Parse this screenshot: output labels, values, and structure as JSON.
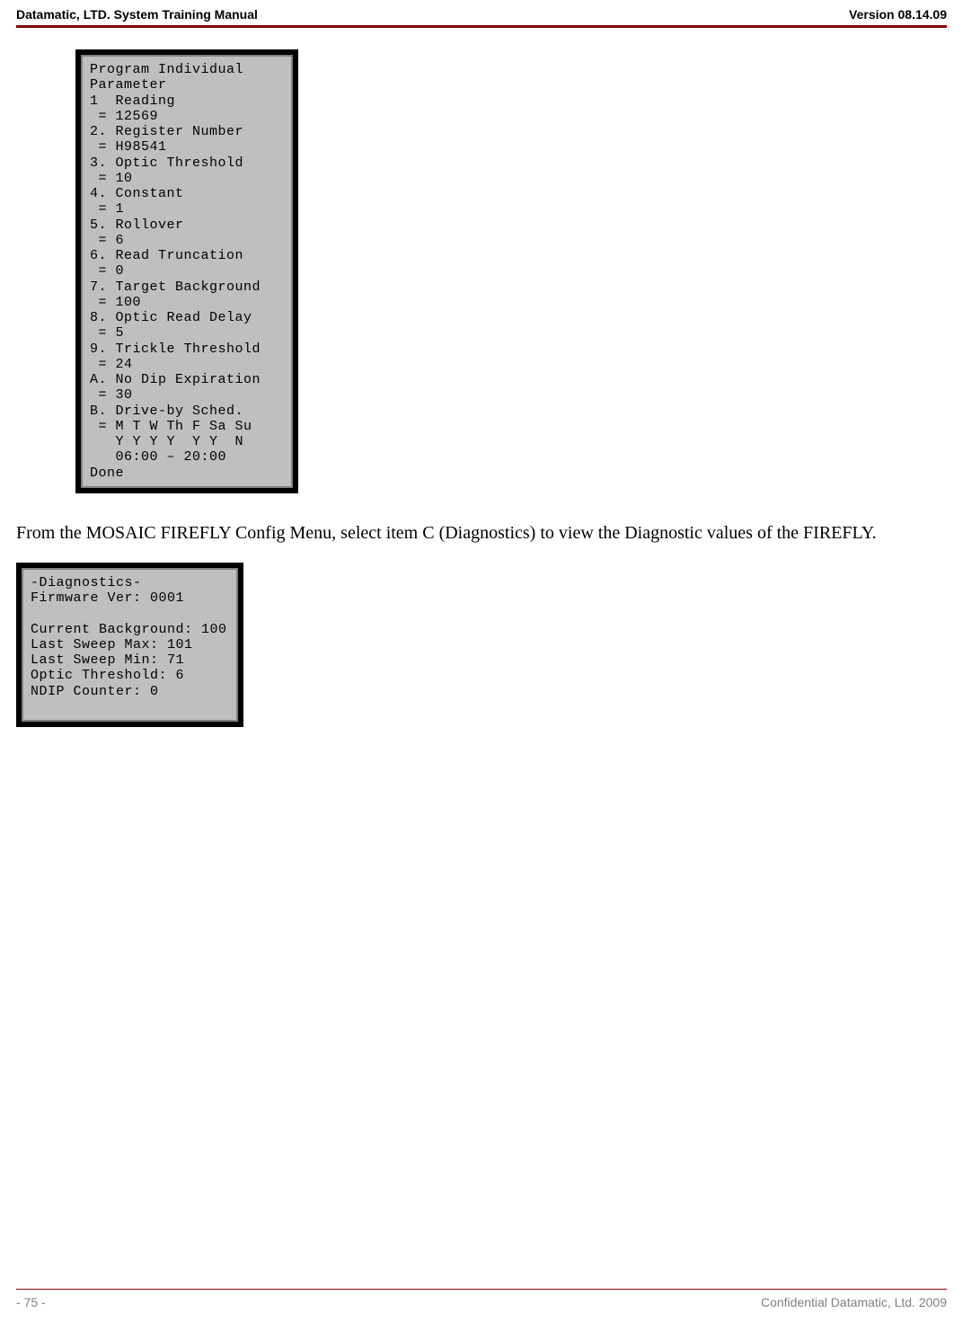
{
  "header": {
    "left": "Datamatic, LTD. System Training  Manual",
    "right": "Version 08.14.09"
  },
  "screen1": {
    "title": "Program Individual",
    "subtitle": "Parameter",
    "items": [
      {
        "label": "1  Reading",
        "value": " = 12569"
      },
      {
        "label": "2. Register Number",
        "value": " = H98541"
      },
      {
        "label": "3. Optic Threshold",
        "value": " = 10"
      },
      {
        "label": "4. Constant",
        "value": " = 1"
      },
      {
        "label": "5. Rollover",
        "value": " = 6"
      },
      {
        "label": "6. Read Truncation",
        "value": " = 0"
      },
      {
        "label": "7. Target Background",
        "value": " = 100"
      },
      {
        "label": "8. Optic Read Delay",
        "value": " = 5"
      },
      {
        "label": "9. Trickle Threshold",
        "value": " = 24"
      },
      {
        "label": "A. No Dip Expiration",
        "value": " = 30"
      },
      {
        "label": "B. Drive-by Sched.",
        "value": " = M T W Th F Sa Su"
      }
    ],
    "sched_flags": "   Y Y Y Y  Y Y  N",
    "sched_time": "   06:00 – 20:00",
    "done": "Done"
  },
  "body_paragraph": "From the MOSAIC FIREFLY Config Menu, select item C  (Diagnostics) to view the Diagnostic values of the FIREFLY.",
  "screen2": {
    "title": "-Diagnostics-",
    "lines": [
      "Firmware Ver: 0001",
      "",
      "Current Background: 100",
      "Last Sweep Max: 101",
      "Last Sweep Min: 71",
      "Optic Threshold: 6",
      "NDIP Counter: 0"
    ]
  },
  "footer": {
    "left": "- 75 -",
    "right": "Confidential Datamatic, Ltd. 2009"
  }
}
